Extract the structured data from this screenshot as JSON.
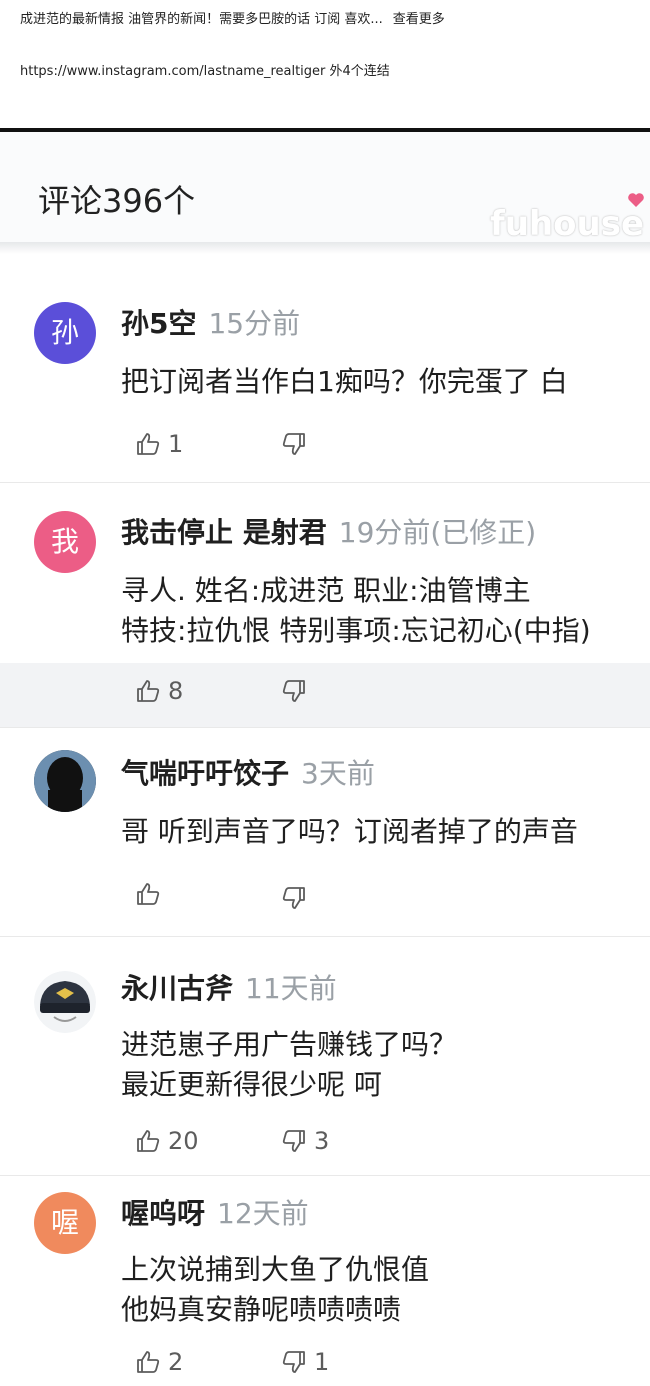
{
  "description": {
    "text": "成进范的最新情报 油管界的新闻！需要多巴胺的话 订阅 喜欢...",
    "more": "查看更多"
  },
  "link": "https://www.instagram.com/lastname_realtiger 外4个连结",
  "comments_header": {
    "title": "评论396个",
    "watermark": "fuhouse"
  },
  "comments": [
    {
      "avatar_char": "孙",
      "avatar_color": "#5b4fd9",
      "author": "孙5空",
      "time": "15分前",
      "lines": [
        "把订阅者当作白1痴吗？你完蛋了 白"
      ],
      "likes": "1",
      "replies": ""
    },
    {
      "avatar_char": "我",
      "avatar_color": "#ec5d86",
      "author": "我击停止 是射君",
      "time": "19分前(已修正)",
      "lines": [
        "寻人. 姓名:成进范 职业:油管博主",
        "特技:拉仇恨 特别事项:忘记初心(中指)"
      ],
      "likes": "8",
      "replies": ""
    },
    {
      "avatar_char": "",
      "avatar_color": "#3b4a58",
      "author": "气喘吁吁饺子",
      "time": "3天前",
      "lines": [
        "哥 听到声音了吗？订阅者掉了的声音"
      ],
      "likes": "",
      "replies": ""
    },
    {
      "avatar_char": "",
      "avatar_color": "#2d3440",
      "author": "永川古斧",
      "time": "11天前",
      "lines": [
        "进范崽子用广告赚钱了吗？",
        "最近更新得很少呢 呵"
      ],
      "likes": "20",
      "replies": "3"
    },
    {
      "avatar_char": "喔",
      "avatar_color": "#f08a5d",
      "author": "喔呜呀",
      "time": "12天前",
      "lines": [
        "上次说捕到大鱼了仇恨值",
        "他妈真安静呢啧啧啧啧"
      ],
      "likes": "2",
      "replies": "1"
    }
  ]
}
